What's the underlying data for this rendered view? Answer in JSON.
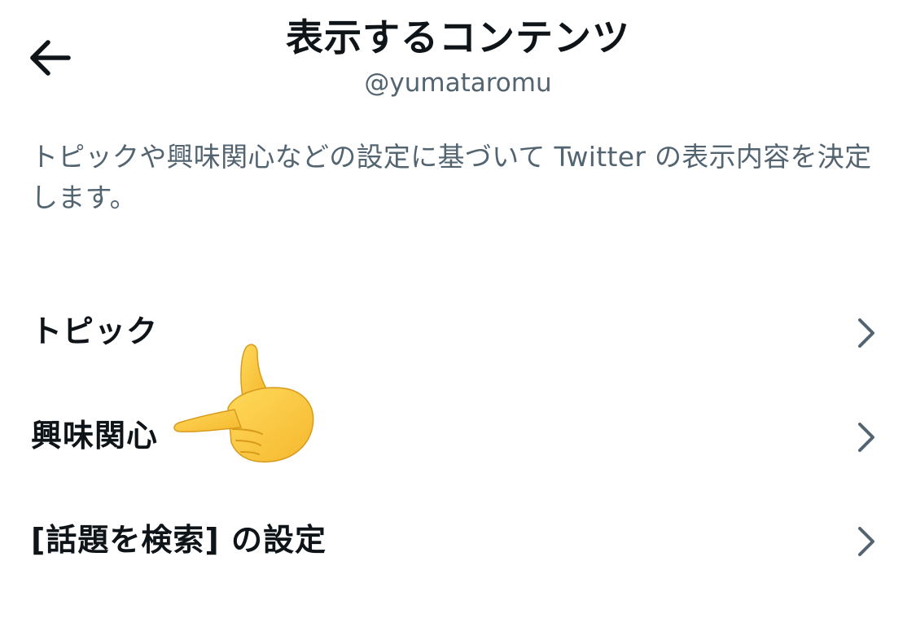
{
  "header": {
    "back_icon": "arrow-left-icon",
    "title": "表示するコンテンツ",
    "subtitle": "@yumataromu"
  },
  "description": "トピックや興味関心などの設定に基づいて Twitter の表示内容を決定します。",
  "menu": {
    "items": [
      {
        "label": "トピック",
        "icon": "chevron-right-icon"
      },
      {
        "label": "興味関心",
        "icon": "chevron-right-icon"
      },
      {
        "label": "[話題を検索] の設定",
        "icon": "chevron-right-icon"
      }
    ]
  },
  "overlay": {
    "icon": "pointing-hand-emoji"
  },
  "colors": {
    "text_primary": "#0f1419",
    "text_secondary": "#536471",
    "chevron": "#536471",
    "emoji": "#ffc83d",
    "background": "#ffffff"
  }
}
